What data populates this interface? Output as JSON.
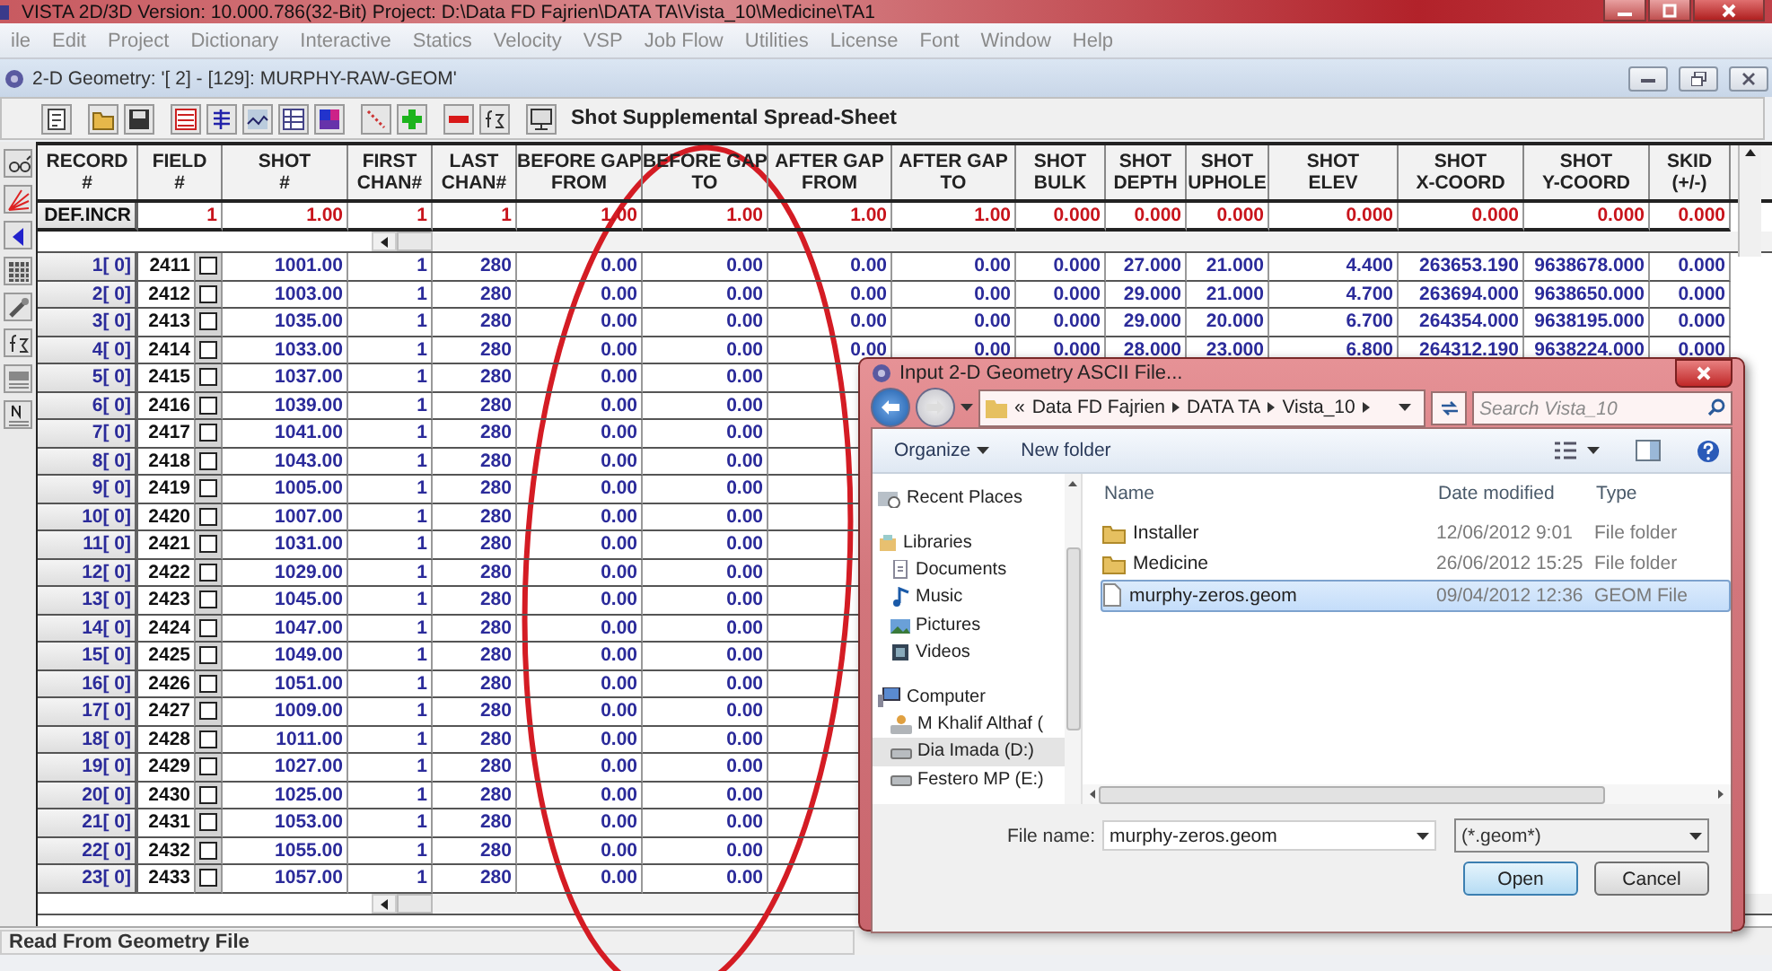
{
  "window": {
    "title": "VISTA 2D/3D Version: 10.000.786(32-Bit) Project: D:\\Data FD Fajrien\\DATA TA\\Vista_10\\Medicine\\TA1"
  },
  "menu": [
    "ile",
    "Edit",
    "Project",
    "Dictionary",
    "Interactive",
    "Statics",
    "Velocity",
    "VSP",
    "Job Flow",
    "Utilities",
    "License",
    "Font",
    "Window",
    "Help"
  ],
  "child_window": {
    "title": "2-D Geometry: '[  2] - [129]: MURPHY-RAW-GEOM'"
  },
  "toolbar": {
    "title": "Shot Supplemental Spread-Sheet"
  },
  "table": {
    "columns": [
      {
        "lines": [
          "RECORD",
          "#"
        ]
      },
      {
        "lines": [
          "FIELD",
          "#"
        ]
      },
      {
        "lines": [
          "SHOT",
          "#"
        ]
      },
      {
        "lines": [
          "FIRST",
          "CHAN#"
        ]
      },
      {
        "lines": [
          "LAST",
          "CHAN#"
        ]
      },
      {
        "lines": [
          "BEFORE GAP",
          "FROM"
        ]
      },
      {
        "lines": [
          "BEFORE GAP",
          "TO"
        ]
      },
      {
        "lines": [
          "AFTER GAP",
          "FROM"
        ]
      },
      {
        "lines": [
          "AFTER GAP",
          "TO"
        ]
      },
      {
        "lines": [
          "SHOT",
          "BULK"
        ]
      },
      {
        "lines": [
          "SHOT",
          "DEPTH"
        ]
      },
      {
        "lines": [
          "SHOT",
          "UPHOLE"
        ]
      },
      {
        "lines": [
          "SHOT",
          "ELEV"
        ]
      },
      {
        "lines": [
          "SHOT",
          "X-COORD"
        ]
      },
      {
        "lines": [
          "SHOT",
          "Y-COORD"
        ]
      },
      {
        "lines": [
          "SKID",
          "(+/-)"
        ]
      }
    ],
    "default_row": {
      "cells": [
        "DEF.INCR",
        "1",
        "1.00",
        "1",
        "1",
        "1.00",
        "1.00",
        "1.00",
        "1.00",
        "0.000",
        "0.000",
        "0.000",
        "0.000",
        "0.000",
        "0.000",
        "0.000"
      ]
    },
    "rows": [
      {
        "checked": false,
        "cells": [
          "1[ 0]",
          "2411",
          "1001.00",
          "1",
          "280",
          "0.00",
          "0.00",
          "0.00",
          "0.00",
          "0.000",
          "27.000",
          "21.000",
          "4.400",
          "263653.190",
          "9638678.000",
          "0.000"
        ]
      },
      {
        "checked": false,
        "cells": [
          "2[ 0]",
          "2412",
          "1003.00",
          "1",
          "280",
          "0.00",
          "0.00",
          "0.00",
          "0.00",
          "0.000",
          "29.000",
          "21.000",
          "4.700",
          "263694.000",
          "9638650.000",
          "0.000"
        ]
      },
      {
        "checked": false,
        "cells": [
          "3[ 0]",
          "2413",
          "1035.00",
          "1",
          "280",
          "0.00",
          "0.00",
          "0.00",
          "0.00",
          "0.000",
          "29.000",
          "20.000",
          "6.700",
          "264354.000",
          "9638195.000",
          "0.000"
        ]
      },
      {
        "checked": false,
        "cells": [
          "4[ 0]",
          "2414",
          "1033.00",
          "1",
          "280",
          "0.00",
          "0.00",
          "0.00",
          "0.00",
          "0.000",
          "28.000",
          "23.000",
          "6.800",
          "264312.190",
          "9638224.000",
          "0.000"
        ]
      },
      {
        "checked": false,
        "cells": [
          "5[ 0]",
          "2415",
          "1037.00",
          "1",
          "280",
          "0.00",
          "0.00"
        ]
      },
      {
        "checked": false,
        "cells": [
          "6[ 0]",
          "2416",
          "1039.00",
          "1",
          "280",
          "0.00",
          "0.00"
        ]
      },
      {
        "checked": false,
        "cells": [
          "7[ 0]",
          "2417",
          "1041.00",
          "1",
          "280",
          "0.00",
          "0.00"
        ]
      },
      {
        "checked": false,
        "cells": [
          "8[ 0]",
          "2418",
          "1043.00",
          "1",
          "280",
          "0.00",
          "0.00"
        ]
      },
      {
        "checked": false,
        "cells": [
          "9[ 0]",
          "2419",
          "1005.00",
          "1",
          "280",
          "0.00",
          "0.00"
        ]
      },
      {
        "checked": false,
        "cells": [
          "10[ 0]",
          "2420",
          "1007.00",
          "1",
          "280",
          "0.00",
          "0.00"
        ]
      },
      {
        "checked": false,
        "cells": [
          "11[ 0]",
          "2421",
          "1031.00",
          "1",
          "280",
          "0.00",
          "0.00"
        ]
      },
      {
        "checked": false,
        "cells": [
          "12[ 0]",
          "2422",
          "1029.00",
          "1",
          "280",
          "0.00",
          "0.00"
        ]
      },
      {
        "checked": false,
        "cells": [
          "13[ 0]",
          "2423",
          "1045.00",
          "1",
          "280",
          "0.00",
          "0.00"
        ]
      },
      {
        "checked": false,
        "cells": [
          "14[ 0]",
          "2424",
          "1047.00",
          "1",
          "280",
          "0.00",
          "0.00"
        ]
      },
      {
        "checked": false,
        "cells": [
          "15[ 0]",
          "2425",
          "1049.00",
          "1",
          "280",
          "0.00",
          "0.00"
        ]
      },
      {
        "checked": false,
        "cells": [
          "16[ 0]",
          "2426",
          "1051.00",
          "1",
          "280",
          "0.00",
          "0.00"
        ]
      },
      {
        "checked": false,
        "cells": [
          "17[ 0]",
          "2427",
          "1009.00",
          "1",
          "280",
          "0.00",
          "0.00"
        ]
      },
      {
        "checked": false,
        "cells": [
          "18[ 0]",
          "2428",
          "1011.00",
          "1",
          "280",
          "0.00",
          "0.00"
        ]
      },
      {
        "checked": false,
        "cells": [
          "19[ 0]",
          "2429",
          "1027.00",
          "1",
          "280",
          "0.00",
          "0.00"
        ]
      },
      {
        "checked": false,
        "cells": [
          "20[ 0]",
          "2430",
          "1025.00",
          "1",
          "280",
          "0.00",
          "0.00"
        ]
      },
      {
        "checked": false,
        "cells": [
          "21[ 0]",
          "2431",
          "1053.00",
          "1",
          "280",
          "0.00",
          "0.00"
        ]
      },
      {
        "checked": false,
        "cells": [
          "22[ 0]",
          "2432",
          "1055.00",
          "1",
          "280",
          "0.00",
          "0.00"
        ]
      },
      {
        "checked": false,
        "cells": [
          "23[ 0]",
          "2433",
          "1057.00",
          "1",
          "280",
          "0.00",
          "0.00"
        ]
      }
    ]
  },
  "annotations": [
    {
      "kind": "ellipse"
    }
  ],
  "status_bar": "Read From Geometry File",
  "dialog": {
    "title": "Input 2-D Geometry ASCII File...",
    "breadcrumb": {
      "overflow": "«",
      "items": [
        "Data FD Fajrien",
        "DATA TA",
        "Vista_10"
      ]
    },
    "search": {
      "placeholder": "Search Vista_10"
    },
    "commands": [
      {
        "label": "Organize",
        "kind": "menu"
      },
      {
        "label": "New folder",
        "kind": "button"
      }
    ],
    "nav": [
      {
        "label": "Recent Places",
        "kind": "recent",
        "selected": false
      },
      {
        "label": "Libraries",
        "kind": "library",
        "selected": false,
        "children": [
          {
            "label": "Documents",
            "kind": "documents",
            "selected": false
          },
          {
            "label": "Music",
            "kind": "music",
            "selected": false
          },
          {
            "label": "Pictures",
            "kind": "pictures",
            "selected": false
          },
          {
            "label": "Videos",
            "kind": "videos",
            "selected": false
          }
        ]
      },
      {
        "label": "Computer",
        "kind": "computer",
        "selected": false,
        "children": [
          {
            "label": "M Khalif Althaf (",
            "kind": "user",
            "selected": false
          },
          {
            "label": "Dia Imada (D:)",
            "kind": "drive",
            "selected": true
          },
          {
            "label": "Festero MP (E:)",
            "kind": "drive",
            "selected": false
          }
        ]
      }
    ],
    "columns": [
      "Name",
      "Date modified",
      "Type"
    ],
    "files": [
      {
        "name": "Installer",
        "date": "12/06/2012 9:01",
        "type": "File folder",
        "kind": "folder",
        "selected": false
      },
      {
        "name": "Medicine",
        "date": "26/06/2012 15:25",
        "type": "File folder",
        "kind": "folder",
        "selected": false
      },
      {
        "name": "murphy-zeros.geom",
        "date": "09/04/2012 12:36",
        "type": "GEOM File",
        "kind": "file",
        "selected": true
      }
    ],
    "file_name": {
      "label": "File name:",
      "value": "murphy-zeros.geom"
    },
    "filter": "(*.geom*)",
    "buttons": [
      {
        "label": "Open",
        "kind": "default"
      },
      {
        "label": "Cancel",
        "kind": "normal"
      }
    ]
  }
}
